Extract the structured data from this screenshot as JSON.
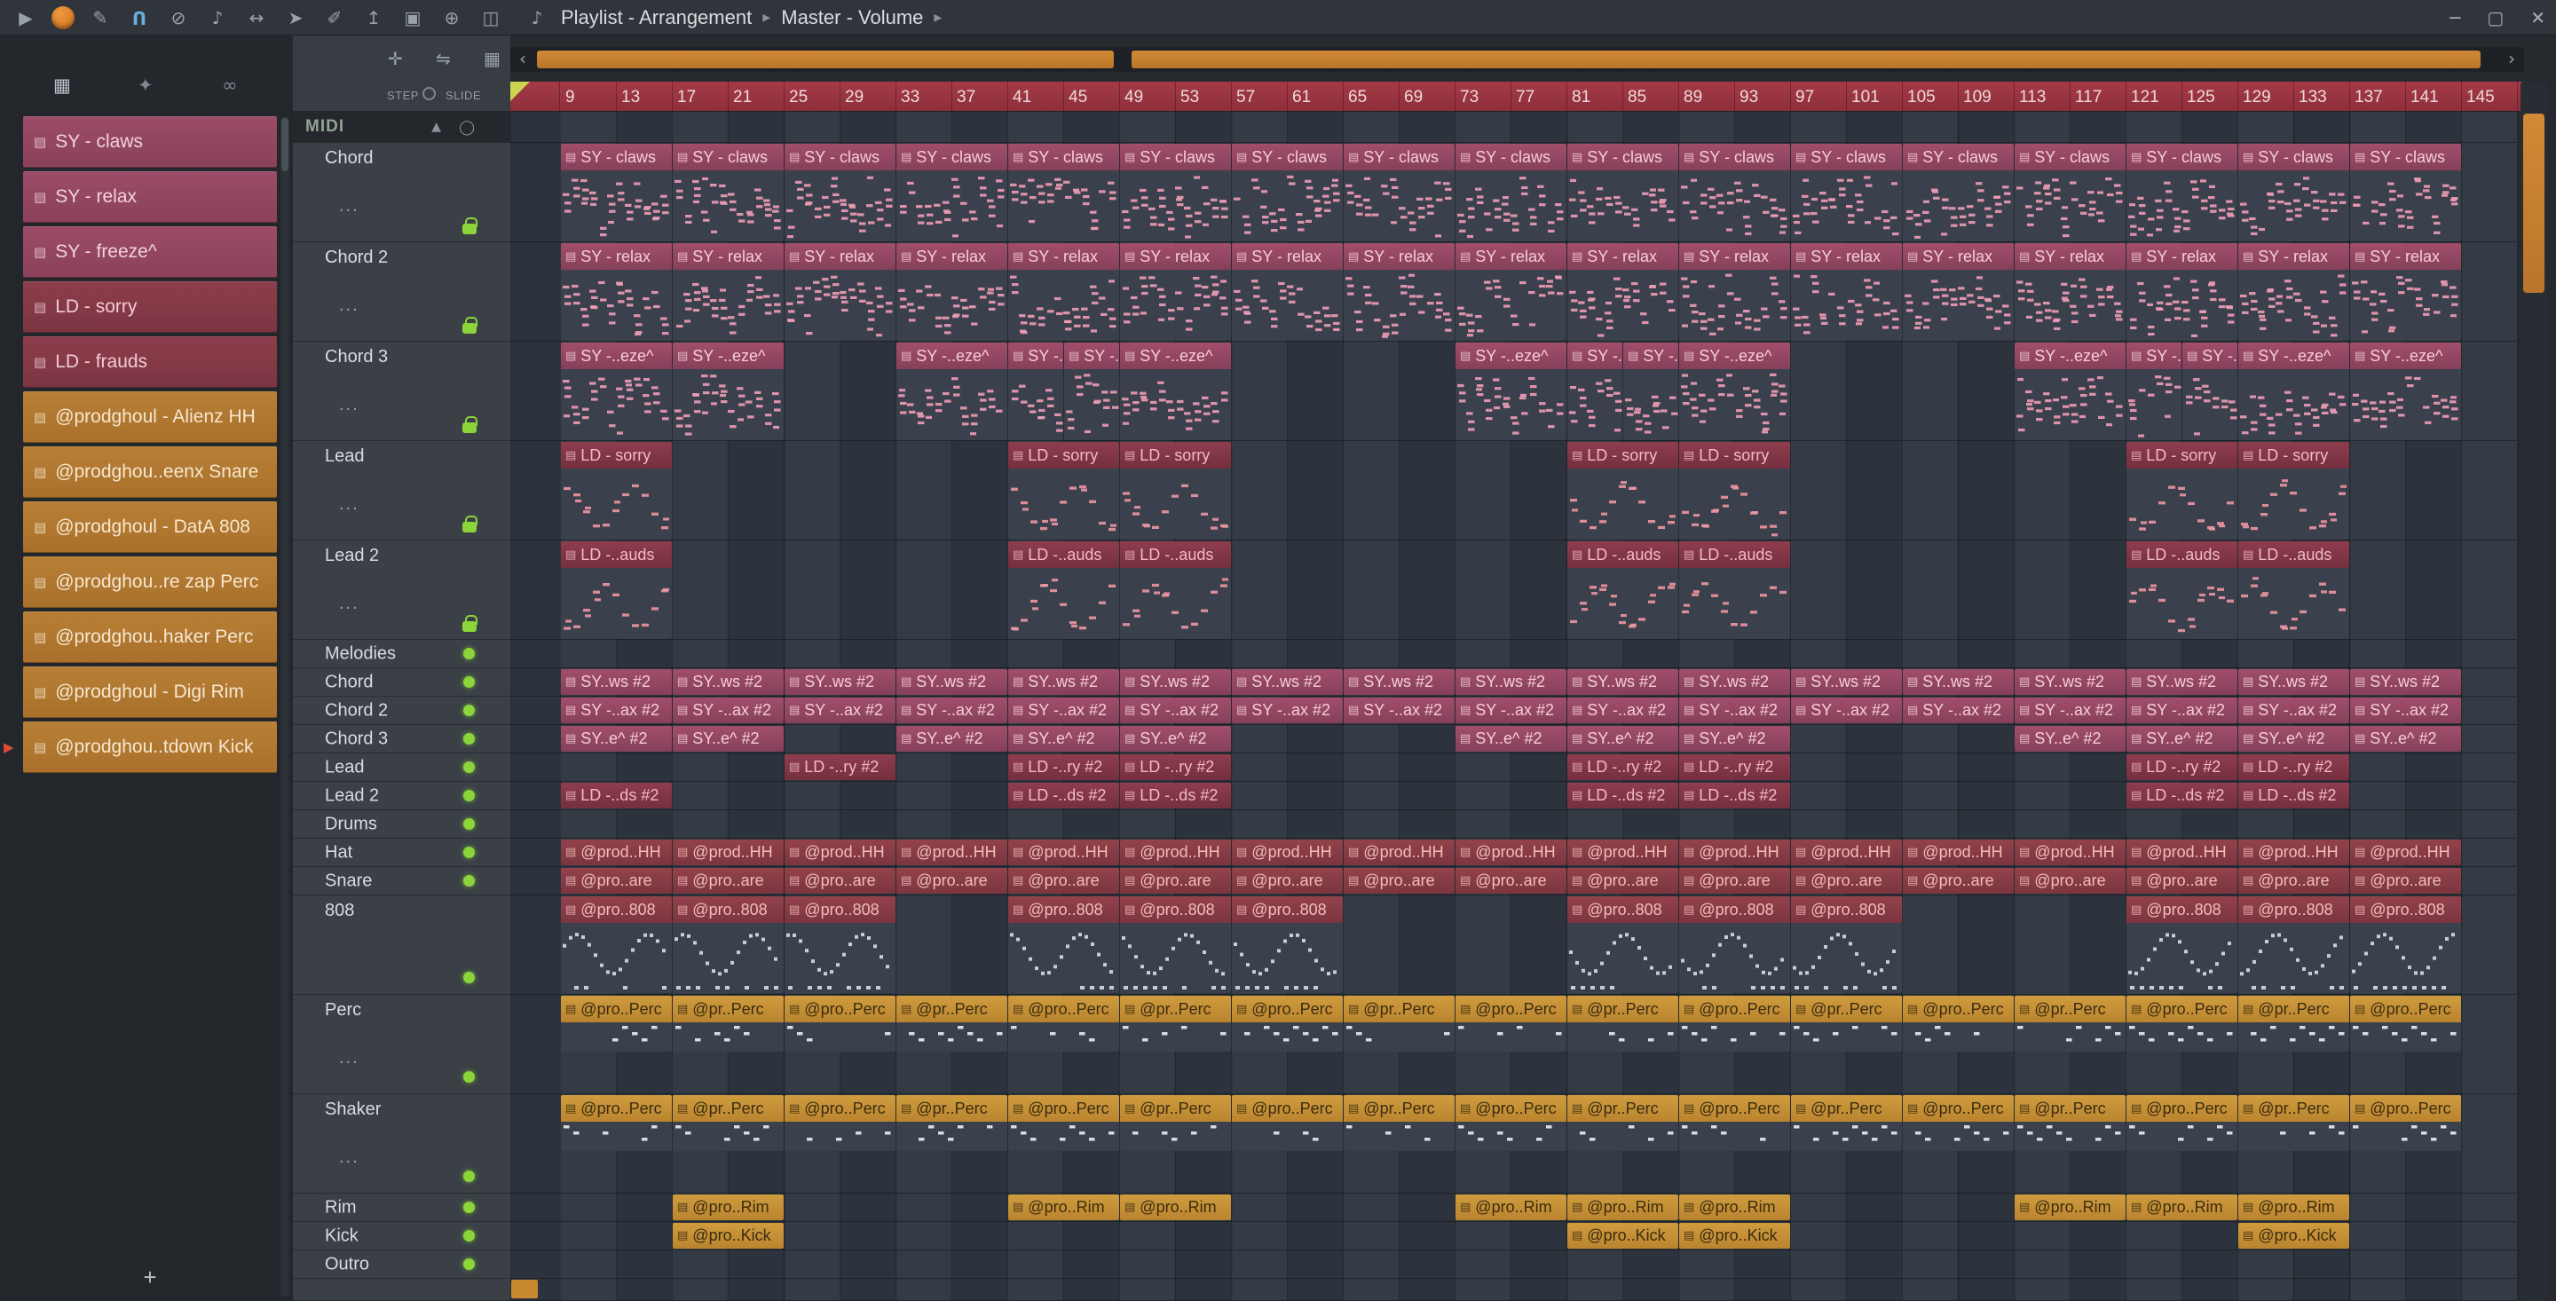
{
  "window": {
    "title_left": "Playlist - Arrangement",
    "title_right": "Master - Volume",
    "separator_glyph": "▸",
    "minimize_glyph": "─",
    "maximize_glyph": "▢",
    "close_glyph": "✕"
  },
  "toolbar": {
    "icons": [
      {
        "name": "play-icon",
        "glyph": "▶"
      },
      {
        "name": "fl-logo",
        "glyph": "",
        "logo": true
      },
      {
        "name": "paperclip-icon",
        "glyph": "✎"
      },
      {
        "name": "magnet-icon",
        "glyph": "U",
        "magnet": true
      },
      {
        "name": "no-snap-icon",
        "glyph": "⊘"
      },
      {
        "name": "mute-icon",
        "glyph": "♪"
      },
      {
        "name": "resize-icon",
        "glyph": "↔"
      },
      {
        "name": "pointer-icon",
        "glyph": "➤"
      },
      {
        "name": "pencil-icon",
        "glyph": "✐"
      },
      {
        "name": "up-arrow-icon",
        "glyph": "↥"
      },
      {
        "name": "frame-icon",
        "glyph": "▣"
      },
      {
        "name": "zoom-icon",
        "glyph": "⊕"
      },
      {
        "name": "monitor-icon",
        "glyph": "◫"
      }
    ],
    "speaker_glyph": "♪"
  },
  "subheader": {
    "picker_tabs": [
      {
        "name": "patterns-tab-icon",
        "glyph": "▦"
      },
      {
        "name": "star-tab-icon",
        "glyph": "✦"
      },
      {
        "name": "link-tab-icon",
        "glyph": "∞"
      }
    ],
    "playlist_tools": [
      {
        "name": "move-tool-icon",
        "glyph": "✛"
      },
      {
        "name": "slide-tool-icon",
        "glyph": "⇋"
      },
      {
        "name": "grid-tool-icon",
        "glyph": "▦"
      }
    ],
    "step_label": "STEP",
    "slide_label": "SLIDE",
    "scroll_left_glyph": "‹",
    "scroll_right_glyph": "›"
  },
  "picker": {
    "icon_glyph": "▤",
    "add_label": "+",
    "items": [
      {
        "label": "SY - claws",
        "style": "sy"
      },
      {
        "label": "SY - relax",
        "style": "sy"
      },
      {
        "label": "SY - freeze^",
        "style": "sy"
      },
      {
        "label": "LD - sorry",
        "style": "ld"
      },
      {
        "label": "LD - frauds",
        "style": "ld"
      },
      {
        "label": "@prodghoul - Alienz HH",
        "style": "or"
      },
      {
        "label": "@prodghou..eenx Snare",
        "style": "or"
      },
      {
        "label": "@prodghoul - DatA 808",
        "style": "or"
      },
      {
        "label": "@prodghou..re zap Perc",
        "style": "or"
      },
      {
        "label": "@prodghou..haker Perc",
        "style": "or"
      },
      {
        "label": "@prodghoul - Digi Rim",
        "style": "or"
      },
      {
        "label": "@prodghou..tdown Kick",
        "style": "or",
        "cursor": true
      }
    ]
  },
  "ruler": {
    "labels": [
      9,
      13,
      17,
      21,
      25,
      29,
      33,
      37,
      41,
      45,
      49,
      53,
      57,
      61,
      65,
      69,
      73,
      77,
      81,
      85,
      89,
      93,
      97,
      101,
      105,
      109,
      113,
      117,
      121,
      125,
      129,
      133,
      137,
      141,
      145
    ],
    "clipped_label": "14"
  },
  "group_header": {
    "label": "MIDI",
    "collapse_glyph": "▲",
    "circle_glyph": "◯"
  },
  "colors": {
    "accent_orange": "#c07a2e",
    "green_light": "#8bd53a",
    "ruler_red": "#9b3642",
    "note_sy": "#f09cb4",
    "note_ld": "#ee96a2",
    "note_drum": "#d9dde3",
    "note_or": "#e9edf1"
  },
  "tracks": [
    {
      "name": "MIDI",
      "kind": "group",
      "clips": []
    },
    {
      "name": "Chord",
      "kind": "big",
      "badge": "lock",
      "dots": "...",
      "style": "sy",
      "preview": "notes",
      "label": "SY - claws",
      "clips": [
        [
          0,
          2
        ],
        [
          2,
          2
        ],
        [
          4,
          2
        ],
        [
          6,
          2
        ],
        [
          8,
          2
        ],
        [
          10,
          2
        ],
        [
          12,
          2
        ],
        [
          14,
          2
        ],
        [
          16,
          2
        ],
        [
          18,
          2
        ],
        [
          20,
          2
        ],
        [
          22,
          2
        ],
        [
          24,
          2
        ],
        [
          26,
          2
        ],
        [
          28,
          2
        ],
        [
          30,
          2
        ],
        [
          32,
          2
        ]
      ]
    },
    {
      "name": "Chord 2",
      "kind": "big",
      "badge": "lock",
      "dots": "...",
      "style": "sy",
      "preview": "notes",
      "label": "SY - relax",
      "clips": [
        [
          0,
          2
        ],
        [
          2,
          2
        ],
        [
          4,
          2
        ],
        [
          6,
          2
        ],
        [
          8,
          2
        ],
        [
          10,
          2
        ],
        [
          12,
          2
        ],
        [
          14,
          2
        ],
        [
          16,
          2
        ],
        [
          18,
          2
        ],
        [
          20,
          2
        ],
        [
          22,
          2
        ],
        [
          24,
          2
        ],
        [
          26,
          2
        ],
        [
          28,
          2
        ],
        [
          30,
          2
        ],
        [
          32,
          2
        ]
      ]
    },
    {
      "name": "Chord 3",
      "kind": "big",
      "badge": "lock",
      "dots": "...",
      "style": "sy",
      "preview": "notes",
      "label": "SY -..eze^",
      "clips": [
        [
          0,
          2
        ],
        [
          2,
          2
        ],
        [
          6,
          2
        ],
        [
          8,
          1
        ],
        [
          9,
          1
        ],
        [
          10,
          2
        ],
        [
          16,
          2
        ],
        [
          18,
          1
        ],
        [
          19,
          1
        ],
        [
          20,
          2
        ],
        [
          26,
          2
        ],
        [
          28,
          1
        ],
        [
          29,
          1
        ],
        [
          30,
          2
        ],
        [
          32,
          2
        ]
      ]
    },
    {
      "name": "Lead",
      "kind": "big",
      "badge": "lock",
      "dots": "...",
      "style": "ld",
      "preview": "lead",
      "label": "LD - sorry",
      "clips": [
        [
          0,
          2
        ],
        [
          8,
          2
        ],
        [
          10,
          2
        ],
        [
          18,
          2
        ],
        [
          20,
          2
        ],
        [
          28,
          2
        ],
        [
          30,
          2
        ]
      ]
    },
    {
      "name": "Lead 2",
      "kind": "big",
      "badge": "lock",
      "dots": "...",
      "style": "ld",
      "preview": "lead",
      "label": "LD -..auds",
      "clips": [
        [
          0,
          2
        ],
        [
          8,
          2
        ],
        [
          10,
          2
        ],
        [
          18,
          2
        ],
        [
          20,
          2
        ],
        [
          28,
          2
        ],
        [
          30,
          2
        ]
      ]
    },
    {
      "name": "Melodies",
      "kind": "small",
      "badge": "dot",
      "clips": []
    },
    {
      "name": "Chord",
      "kind": "small",
      "badge": "dot",
      "style": "sy",
      "label": "SY..ws #2",
      "clips": [
        [
          0,
          2
        ],
        [
          2,
          2
        ],
        [
          4,
          2
        ],
        [
          6,
          2
        ],
        [
          8,
          2
        ],
        [
          10,
          2
        ],
        [
          12,
          2
        ],
        [
          14,
          2
        ],
        [
          16,
          2
        ],
        [
          18,
          2
        ],
        [
          20,
          2
        ],
        [
          22,
          2
        ],
        [
          24,
          2
        ],
        [
          26,
          2
        ],
        [
          28,
          2
        ],
        [
          30,
          2
        ],
        [
          32,
          2
        ]
      ]
    },
    {
      "name": "Chord 2",
      "kind": "small",
      "badge": "dot",
      "style": "sy",
      "label": "SY -..ax #2",
      "clips": [
        [
          0,
          2
        ],
        [
          2,
          2
        ],
        [
          4,
          2
        ],
        [
          6,
          2
        ],
        [
          8,
          2
        ],
        [
          10,
          2
        ],
        [
          12,
          2
        ],
        [
          14,
          2
        ],
        [
          16,
          2
        ],
        [
          18,
          2
        ],
        [
          20,
          2
        ],
        [
          22,
          2
        ],
        [
          24,
          2
        ],
        [
          26,
          2
        ],
        [
          28,
          2
        ],
        [
          30,
          2
        ],
        [
          32,
          2
        ]
      ]
    },
    {
      "name": "Chord 3",
      "kind": "small",
      "badge": "dot",
      "style": "sy",
      "label": "SY..e^ #2",
      "clips": [
        [
          0,
          2
        ],
        [
          2,
          2
        ],
        [
          6,
          2
        ],
        [
          8,
          2
        ],
        [
          10,
          2
        ],
        [
          16,
          2
        ],
        [
          18,
          2
        ],
        [
          20,
          2
        ],
        [
          26,
          2
        ],
        [
          28,
          2
        ],
        [
          30,
          2
        ],
        [
          32,
          2
        ]
      ]
    },
    {
      "name": "Lead",
      "kind": "small",
      "badge": "dot",
      "style": "ld",
      "label": "LD -..ry #2",
      "clips": [
        [
          4,
          2
        ],
        [
          8,
          2
        ],
        [
          10,
          2
        ],
        [
          18,
          2
        ],
        [
          20,
          2
        ],
        [
          28,
          2
        ],
        [
          30,
          2
        ]
      ]
    },
    {
      "name": "Lead 2",
      "kind": "small",
      "badge": "dot",
      "style": "ld",
      "label": "LD -..ds #2",
      "clips": [
        [
          0,
          2
        ],
        [
          8,
          2
        ],
        [
          10,
          2
        ],
        [
          18,
          2
        ],
        [
          20,
          2
        ],
        [
          28,
          2
        ],
        [
          30,
          2
        ]
      ]
    },
    {
      "name": "Drums",
      "kind": "small",
      "badge": "dot",
      "clips": []
    },
    {
      "name": "Hat",
      "kind": "small",
      "badge": "dot",
      "style": "drum",
      "label": "@prod..HH",
      "clips": [
        [
          0,
          2
        ],
        [
          2,
          2
        ],
        [
          4,
          2
        ],
        [
          6,
          2
        ],
        [
          8,
          2
        ],
        [
          10,
          2
        ],
        [
          12,
          2
        ],
        [
          14,
          2
        ],
        [
          16,
          2
        ],
        [
          18,
          2
        ],
        [
          20,
          2
        ],
        [
          22,
          2
        ],
        [
          24,
          2
        ],
        [
          26,
          2
        ],
        [
          28,
          2
        ],
        [
          30,
          2
        ],
        [
          32,
          2
        ]
      ]
    },
    {
      "name": "Snare",
      "kind": "small",
      "badge": "dot",
      "style": "drum",
      "label": "@pro..are",
      "clips": [
        [
          0,
          2
        ],
        [
          2,
          2
        ],
        [
          4,
          2
        ],
        [
          6,
          2
        ],
        [
          8,
          2
        ],
        [
          10,
          2
        ],
        [
          12,
          2
        ],
        [
          14,
          2
        ],
        [
          16,
          2
        ],
        [
          18,
          2
        ],
        [
          20,
          2
        ],
        [
          22,
          2
        ],
        [
          24,
          2
        ],
        [
          26,
          2
        ],
        [
          28,
          2
        ],
        [
          30,
          2
        ],
        [
          32,
          2
        ]
      ]
    },
    {
      "name": "808",
      "kind": "big",
      "badge": "dot",
      "style": "drum",
      "preview": "wave",
      "label": "@pro..808",
      "clips": [
        [
          0,
          2
        ],
        [
          2,
          2
        ],
        [
          4,
          2
        ],
        [
          8,
          2
        ],
        [
          10,
          2
        ],
        [
          12,
          2
        ],
        [
          18,
          2
        ],
        [
          20,
          2
        ],
        [
          22,
          2
        ],
        [
          28,
          2
        ],
        [
          30,
          2
        ],
        [
          32,
          2
        ]
      ]
    },
    {
      "name": "Perc",
      "kind": "big",
      "badge": "dot",
      "dots": "...",
      "style": "or",
      "preview": "ticks",
      "label": "@pro..Perc",
      "label_alt": "@pr..Perc",
      "clips": [
        [
          0,
          2
        ],
        [
          2,
          2
        ],
        [
          4,
          2
        ],
        [
          6,
          2
        ],
        [
          8,
          2
        ],
        [
          10,
          2
        ],
        [
          12,
          2
        ],
        [
          14,
          2
        ],
        [
          16,
          2
        ],
        [
          18,
          2
        ],
        [
          20,
          2
        ],
        [
          22,
          2
        ],
        [
          24,
          2
        ],
        [
          26,
          2
        ],
        [
          28,
          2
        ],
        [
          30,
          2
        ],
        [
          32,
          2
        ]
      ]
    },
    {
      "name": "Shaker",
      "kind": "big",
      "badge": "dot",
      "dots": "...",
      "style": "or",
      "preview": "ticks",
      "label": "@pro..Perc",
      "label_alt": "@pr..Perc",
      "clips": [
        [
          0,
          2
        ],
        [
          2,
          2
        ],
        [
          4,
          2
        ],
        [
          6,
          2
        ],
        [
          8,
          2
        ],
        [
          10,
          2
        ],
        [
          12,
          2
        ],
        [
          14,
          2
        ],
        [
          16,
          2
        ],
        [
          18,
          2
        ],
        [
          20,
          2
        ],
        [
          22,
          2
        ],
        [
          24,
          2
        ],
        [
          26,
          2
        ],
        [
          28,
          2
        ],
        [
          30,
          2
        ],
        [
          32,
          2
        ]
      ]
    },
    {
      "name": "Rim",
      "kind": "small",
      "badge": "dot",
      "style": "or",
      "label": "@pro..Rim",
      "clips": [
        [
          2,
          2
        ],
        [
          8,
          2
        ],
        [
          10,
          2
        ],
        [
          16,
          2
        ],
        [
          18,
          2
        ],
        [
          20,
          2
        ],
        [
          26,
          2
        ],
        [
          28,
          2
        ],
        [
          30,
          2
        ]
      ]
    },
    {
      "name": "Kick",
      "kind": "small",
      "badge": "dot",
      "style": "or",
      "label": "@pro..Kick",
      "clips": [
        [
          2,
          2
        ],
        [
          18,
          2
        ],
        [
          20,
          2
        ],
        [
          30,
          2
        ]
      ]
    },
    {
      "name": "Outro",
      "kind": "small",
      "badge": "dot",
      "clips": []
    },
    {
      "name": "",
      "kind": "partial",
      "clips": [],
      "sliver": true
    }
  ]
}
